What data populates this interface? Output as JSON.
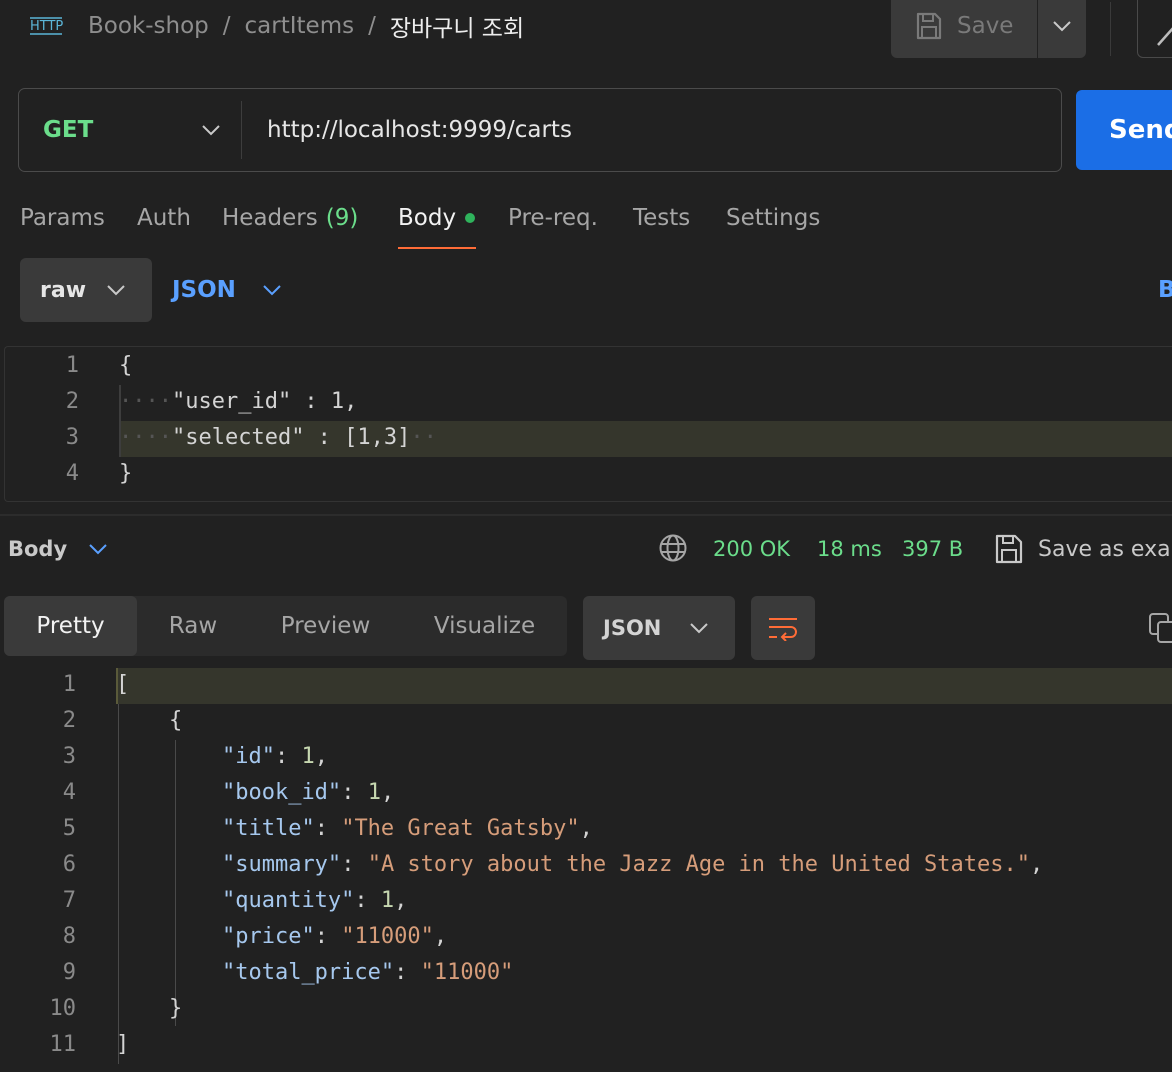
{
  "header": {
    "breadcrumb": [
      "Book-shop",
      "cartItems",
      "장바구니 조회"
    ],
    "separator": "/",
    "save_label": "Save"
  },
  "request": {
    "method": "GET",
    "url": "http://localhost:9999/carts",
    "send_label": "Send"
  },
  "request_tabs": [
    {
      "label": "Params"
    },
    {
      "label": "Auth"
    },
    {
      "label": "Headers",
      "count": "(9)"
    },
    {
      "label": "Body",
      "active": true
    },
    {
      "label": "Pre-req."
    },
    {
      "label": "Tests"
    },
    {
      "label": "Settings"
    }
  ],
  "body_options": {
    "mode": "raw",
    "language": "JSON",
    "beautify_label": "B"
  },
  "request_body": {
    "line_numbers": [
      "1",
      "2",
      "3",
      "4"
    ],
    "lines": [
      "{",
      "\"user_id\" : 1,",
      "\"selected\" : [1,3]",
      "}"
    ],
    "highlighted_line": 3
  },
  "response": {
    "section_label": "Body",
    "status": "200 OK",
    "time": "18 ms",
    "size": "397 B",
    "save_example_label": "Save as exa",
    "view_tabs": [
      "Pretty",
      "Raw",
      "Preview",
      "Visualize"
    ],
    "active_view": "Pretty",
    "format": "JSON",
    "line_numbers": [
      "1",
      "2",
      "3",
      "4",
      "5",
      "6",
      "7",
      "8",
      "9",
      "10",
      "11"
    ],
    "body": [
      {
        "id": 1,
        "book_id": 1,
        "title": "The Great Gatsby",
        "summary": "A story about the Jazz Age in the United States.",
        "quantity": 1,
        "price": "11000",
        "total_price": "11000"
      }
    ],
    "highlighted_line": 1
  },
  "colors": {
    "background": "#212121",
    "accent_orange": "#ff6c37",
    "method_green": "#6bdd8b",
    "send_blue": "#1b6ee6",
    "link_blue": "#5aa0ff"
  },
  "icons": [
    "http-icon",
    "save-icon",
    "chevron-down-icon",
    "edit-icon",
    "globe-icon",
    "wrap-lines-icon",
    "copy-icon"
  ]
}
